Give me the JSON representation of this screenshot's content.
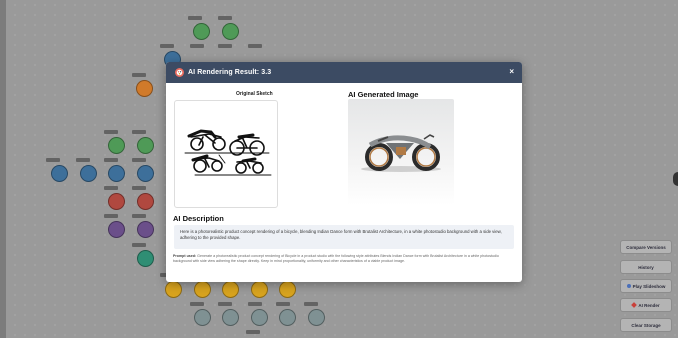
{
  "modal": {
    "title": "AI Rendering Result: 3.3",
    "close_symbol": "×",
    "original_label": "Original Sketch",
    "generated_label": "AI Generated Image",
    "description_heading": "AI Description",
    "description_text": "Here is a photorealistic product concept rendering of a bicycle, blending Indian Dance form with Brutalist Architecture, in a white photostudio background with a side view, adhering to the provided shape.",
    "prompt_label": "Prompt used:",
    "prompt_text": "Generate a photorealistic product concept rendering of Bicycle in a product studio with the following style attributes Blends Indian Dance form with Brutalist Architecture in a white photostudio background with side view adhering the shape directly. Keep in mind proportionality, uniformity and other characteristics of a viable product image."
  },
  "sidebar_buttons": [
    {
      "label": "Compare Versions",
      "icon": ""
    },
    {
      "label": "History",
      "icon": ""
    },
    {
      "label": "Play Slideshow",
      "icon": "play-icon"
    },
    {
      "label": "AI Render",
      "icon": "sparkle-icon"
    },
    {
      "label": "Clear Storage",
      "icon": ""
    }
  ],
  "colors": {
    "header": "#3c4b63",
    "node_green": "#4f9a57",
    "node_blue": "#3d6f9a",
    "node_red": "#b0483f",
    "node_purple": "#6b4f8a",
    "node_teal": "#2f8e74",
    "node_yellow": "#d8a31e",
    "node_gray": "#7f9193",
    "node_orange": "#d07a2a"
  }
}
